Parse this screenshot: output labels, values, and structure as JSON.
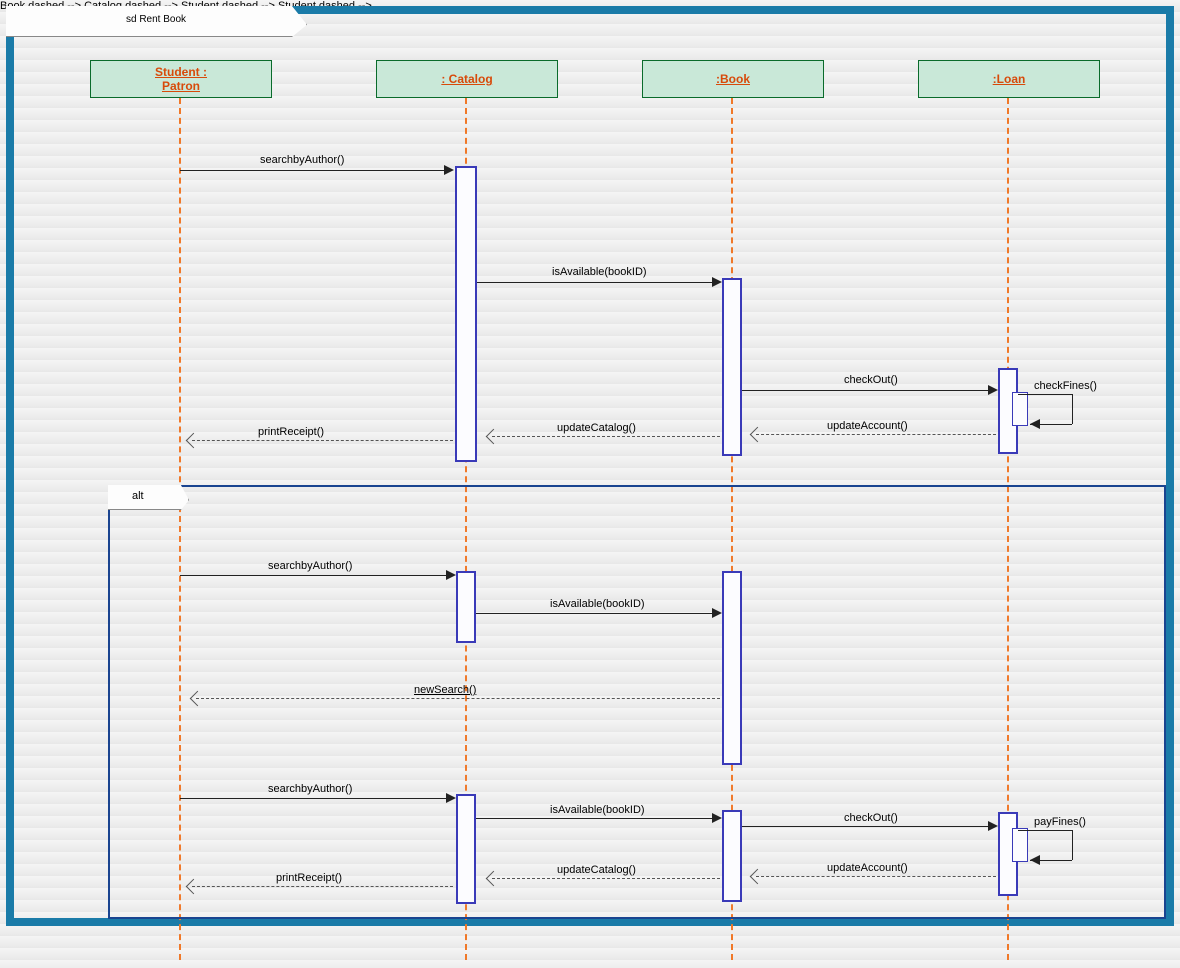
{
  "frame": {
    "title": "sd Rent Book"
  },
  "lifelines": {
    "student": "Student :\nPatron",
    "catalog": ": Catalog",
    "book": ":Book",
    "loan": ":Loan"
  },
  "messages": {
    "m1": "searchbyAuthor()",
    "m2": "isAvailable(bookID)",
    "m3": "checkOut()",
    "m4": "checkFines()",
    "m5": "updateAccount()",
    "m6": "updateCatalog()",
    "m7": "printReceipt()",
    "alt_label": "alt",
    "a1": "searchbyAuthor()",
    "a2": "isAvailable(bookID)",
    "a3": "newSearch()",
    "b1": "searchbyAuthor()",
    "b2": "isAvailable(bookID)",
    "b3": "checkOut()",
    "b4": "payFines()",
    "b5": "updateAccount()",
    "b6": "updateCatalog()",
    "b7": "printReceipt()"
  }
}
